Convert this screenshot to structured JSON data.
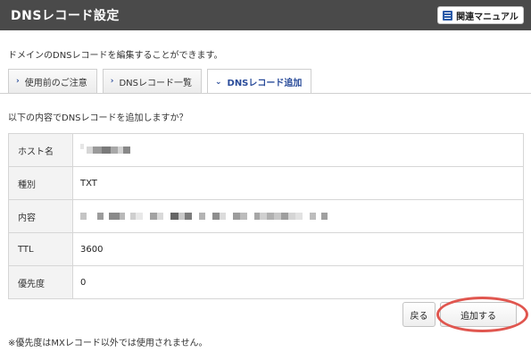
{
  "header": {
    "title": "DNSレコード設定",
    "manual_label": "関連マニュアル"
  },
  "description": "ドメインのDNSレコードを編集することができます。",
  "tabs": [
    {
      "label": "使用前のご注意",
      "active": false
    },
    {
      "label": "DNSレコード一覧",
      "active": false
    },
    {
      "label": "DNSレコード追加",
      "active": true
    }
  ],
  "question": "以下の内容でDNSレコードを追加しますか？",
  "form": {
    "rows": [
      {
        "label": "ホスト名",
        "value": ""
      },
      {
        "label": "種別",
        "value": "TXT"
      },
      {
        "label": "内容",
        "value": ""
      },
      {
        "label": "TTL",
        "value": "3600"
      },
      {
        "label": "優先度",
        "value": "0"
      }
    ]
  },
  "buttons": {
    "back": "戻る",
    "add": "追加する"
  },
  "note": "※優先度はMXレコード以外では使用されません。",
  "colors": {
    "header_bg": "#4a4a4a",
    "tab_active_text": "#2a4c9a",
    "highlight": "#e0564f"
  }
}
